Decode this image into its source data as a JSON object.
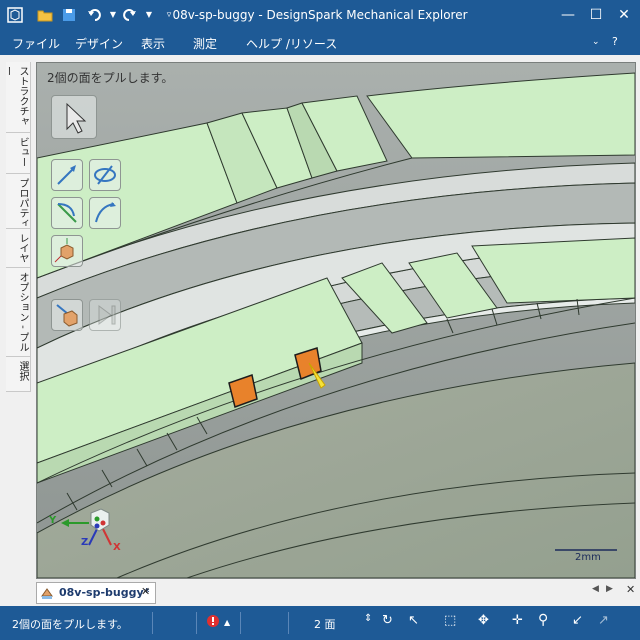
{
  "window": {
    "title": "08v-sp-buggy - DesignSpark Mechanical Explorer"
  },
  "menu": [
    "ファイル",
    "デザイン",
    "表示",
    "測定",
    "ヘルプ /リソース"
  ],
  "left_tabs": [
    "ストラクチャー",
    "ビュー",
    "プロパティ",
    "レイヤ",
    "オプション - プル",
    "選択"
  ],
  "viewport": {
    "hint": "2個の面をプルします。",
    "scale_label": "2mm"
  },
  "axes": {
    "x": "X",
    "y": "Y",
    "z": "Z"
  },
  "document_tab": {
    "label": "08v-sp-buggy*",
    "close": "✕"
  },
  "statusbar": {
    "message": "2個の面をプルします。",
    "selection_count": "2 面"
  },
  "colors": {
    "chrome": "#1e5a96",
    "face_green": "#cdeec5",
    "selected_face": "#e8822b"
  },
  "icons": [
    "app-icon",
    "open-folder-icon",
    "save-icon",
    "undo-icon",
    "redo-icon",
    "select-arrow-icon",
    "pull-icon",
    "move-icon",
    "fill-icon",
    "combine-icon",
    "cube-icon",
    "error-icon",
    "rotate-icon",
    "zoom-icon"
  ]
}
